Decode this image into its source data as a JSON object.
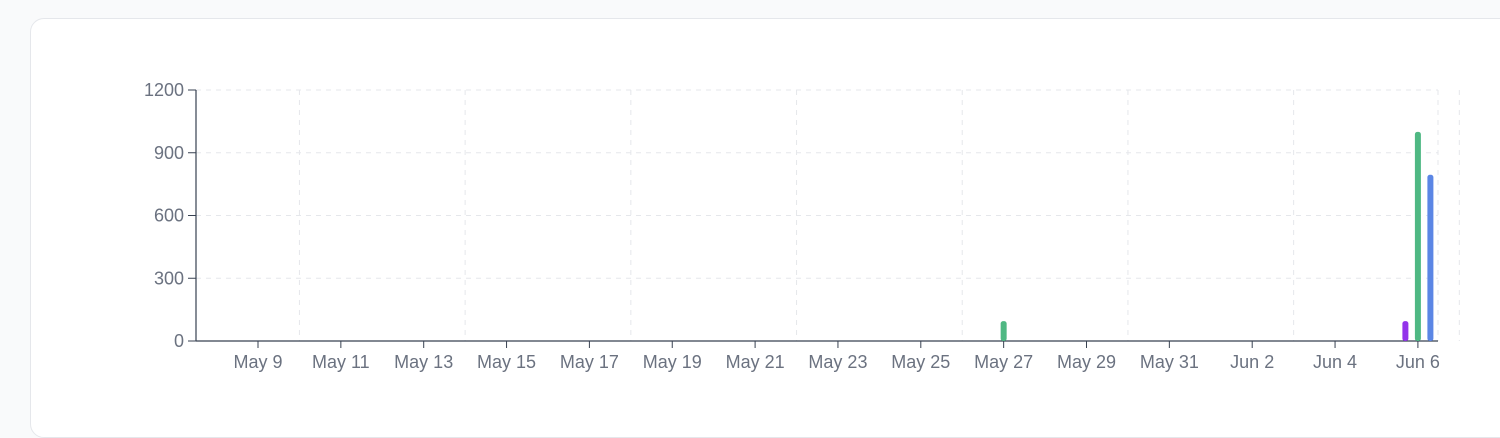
{
  "chart_data": {
    "type": "bar",
    "x_ticks": [
      "May 9",
      "May 11",
      "May 13",
      "May 15",
      "May 17",
      "May 19",
      "May 21",
      "May 23",
      "May 25",
      "May 27",
      "May 29",
      "May 31",
      "Jun 2",
      "Jun 4",
      "Jun 6"
    ],
    "ylim": [
      0,
      1200
    ],
    "y_ticks": [
      0,
      300,
      600,
      900,
      1200
    ],
    "grid": true,
    "series": [
      {
        "color": "#9333ea",
        "points": [
          {
            "date": "Jun 6",
            "value": 95
          }
        ]
      },
      {
        "color": "#4fb883",
        "points": [
          {
            "date": "May 27",
            "value": 95
          },
          {
            "date": "Jun 6",
            "value": 1000
          }
        ]
      },
      {
        "color": "#5b86e5",
        "points": [
          {
            "date": "Jun 6",
            "value": 795
          }
        ]
      }
    ]
  },
  "colors": {
    "axis": "#374151",
    "grid": "#e5e7eb",
    "label": "#6b7280"
  }
}
